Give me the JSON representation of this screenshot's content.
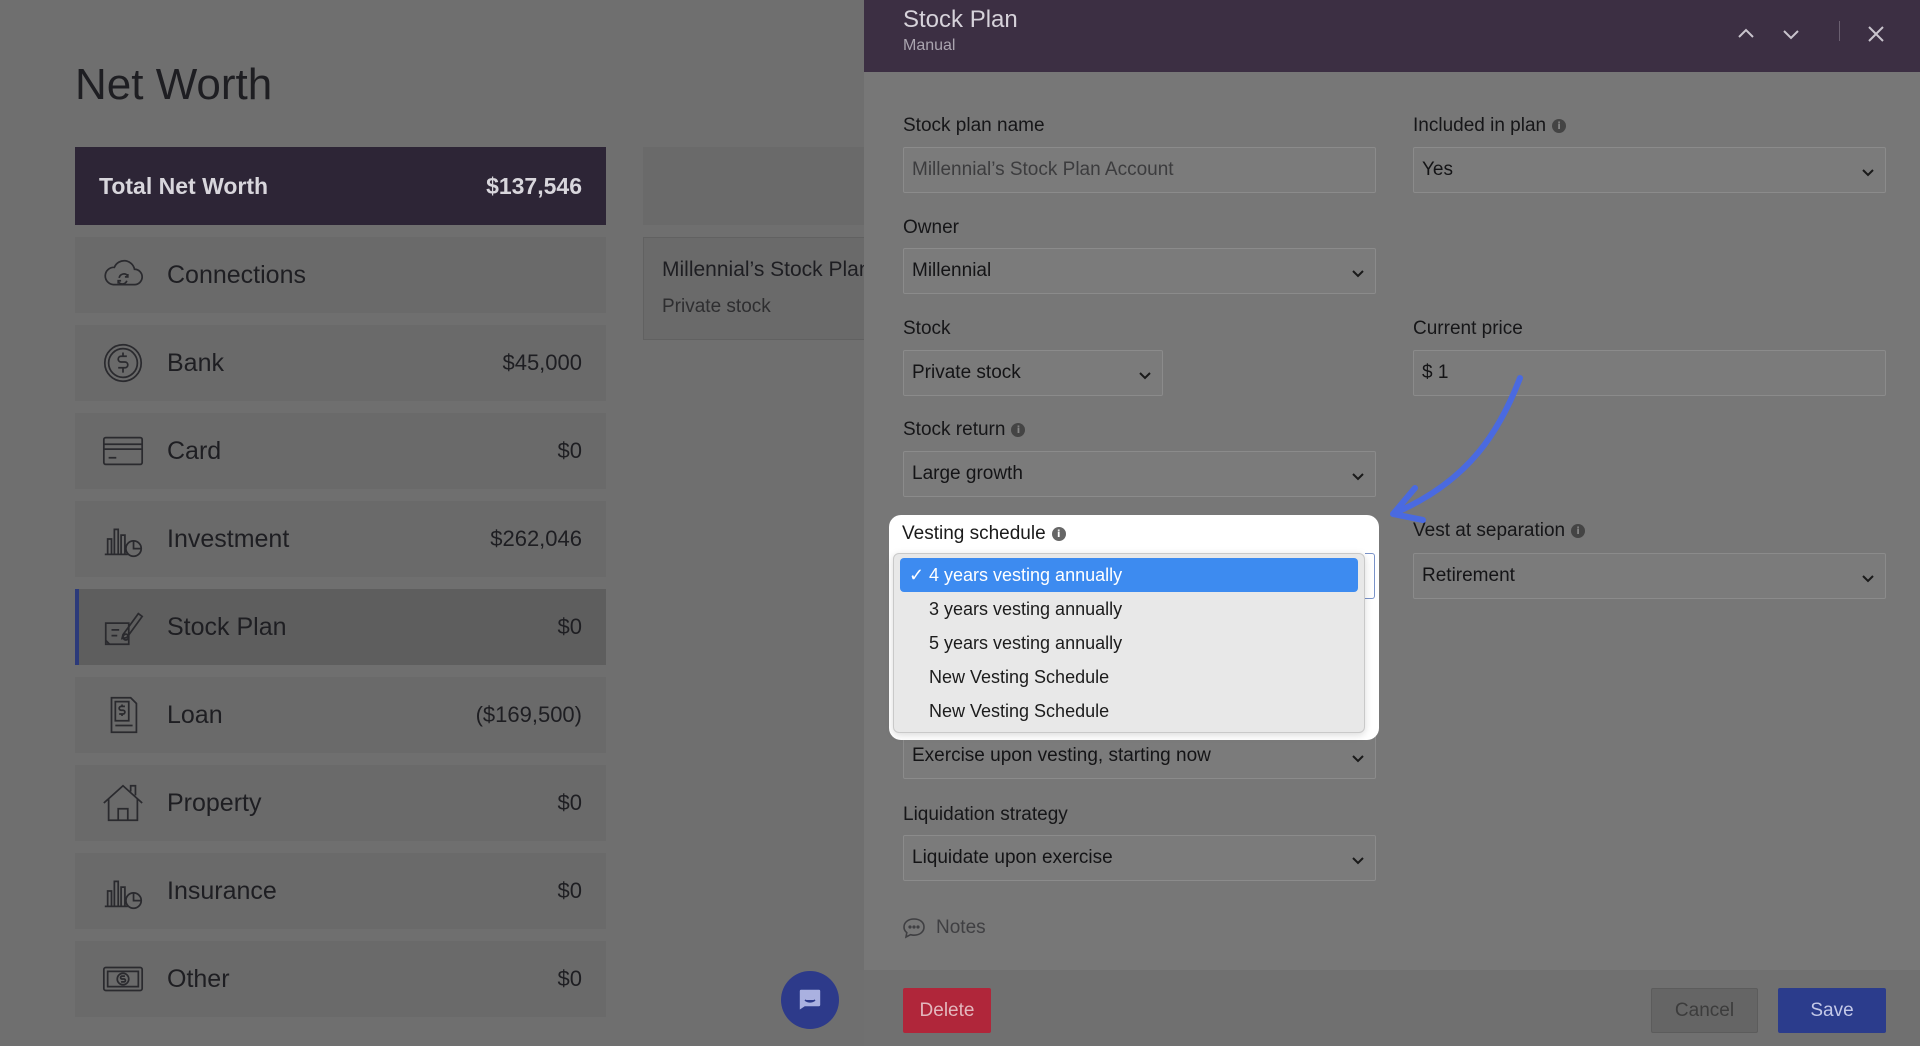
{
  "page": {
    "title": "Net Worth",
    "total": {
      "label": "Total Net Worth",
      "value": "$137,546"
    },
    "nav": [
      {
        "label": "Connections",
        "value": "",
        "icon": "cloud-sync-icon"
      },
      {
        "label": "Bank",
        "value": "$45,000",
        "icon": "dollar-coin-icon"
      },
      {
        "label": "Card",
        "value": "$0",
        "icon": "credit-card-icon"
      },
      {
        "label": "Investment",
        "value": "$262,046",
        "icon": "bar-chart-icon"
      },
      {
        "label": "Stock Plan",
        "value": "$0",
        "icon": "signed-certificate-icon",
        "active": true
      },
      {
        "label": "Loan",
        "value": "($169,500)",
        "icon": "dollar-document-icon"
      },
      {
        "label": "Property",
        "value": "$0",
        "icon": "house-icon"
      },
      {
        "label": "Insurance",
        "value": "$0",
        "icon": "bar-chart-icon"
      },
      {
        "label": "Other",
        "value": "$0",
        "icon": "banknote-icon"
      }
    ],
    "account_card": {
      "title": "Millennial’s Stock Plan",
      "subtitle": "Private stock"
    }
  },
  "drawer": {
    "title": "Stock Plan",
    "subtitle": "Manual",
    "fields": {
      "name_label": "Stock plan name",
      "name_placeholder": "Millennial’s Stock Plan Account",
      "included_label": "Included in plan",
      "included_value": "Yes",
      "owner_label": "Owner",
      "owner_value": "Millennial",
      "stock_label": "Stock",
      "stock_value": "Private stock",
      "price_label": "Current price",
      "price_value": "$ 1",
      "return_label": "Stock return",
      "return_value": "Large growth",
      "vesting_label": "Vesting schedule",
      "separation_label": "Vest at separation",
      "separation_value": "Retirement",
      "exercise_value": "Exercise upon vesting, starting now",
      "liquidation_label": "Liquidation strategy",
      "liquidation_value": "Liquidate upon exercise"
    },
    "vesting_options": [
      {
        "label": "4 years vesting annually",
        "selected": true
      },
      {
        "label": "3 years vesting annually"
      },
      {
        "label": "5 years vesting annually"
      },
      {
        "label": "New Vesting Schedule"
      },
      {
        "label": "New Vesting Schedule"
      }
    ],
    "notes_label": "Notes",
    "buttons": {
      "delete": "Delete",
      "cancel": "Cancel",
      "save": "Save"
    }
  },
  "colors": {
    "header_bg": "#3c2f43",
    "total_bg": "#2d2536",
    "selected_option": "#3d8bf0",
    "delete": "#b0263a",
    "save": "#2b3c8c",
    "annotation_arrow": "#4a6ae0"
  }
}
